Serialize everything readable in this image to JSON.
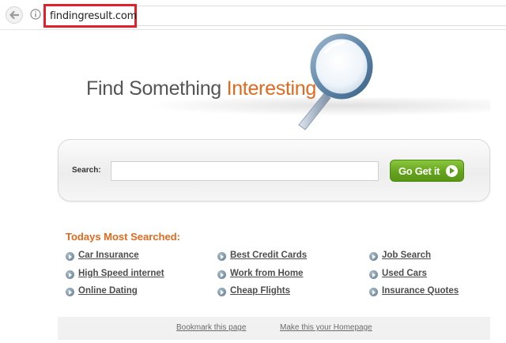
{
  "browser": {
    "url": "findingresult.com"
  },
  "header": {
    "title_main": "Find Something",
    "title_accent": "Interesting"
  },
  "search": {
    "label": "Search:",
    "value": "",
    "button_label": "Go Get it"
  },
  "most_searched": {
    "title": "Todays Most Searched:",
    "items": [
      "Car Insurance",
      "High Speed internet",
      "Online Dating",
      "Best Credit Cards",
      "Work from Home",
      "Cheap Flights",
      "Job Search",
      "Used Cars",
      "Insurance Quotes"
    ]
  },
  "footer": {
    "bookmark_label": "Bookmark this page",
    "homepage_label": "Make this your Homepage"
  },
  "colors": {
    "accent": "#e2691e",
    "button_green": "#64a41c",
    "url_highlight": "#e0202b"
  },
  "icons": [
    "back-arrow-icon",
    "info-icon",
    "magnifying-glass-icon",
    "arrow-right-icon",
    "bullet-arrow-icon"
  ]
}
